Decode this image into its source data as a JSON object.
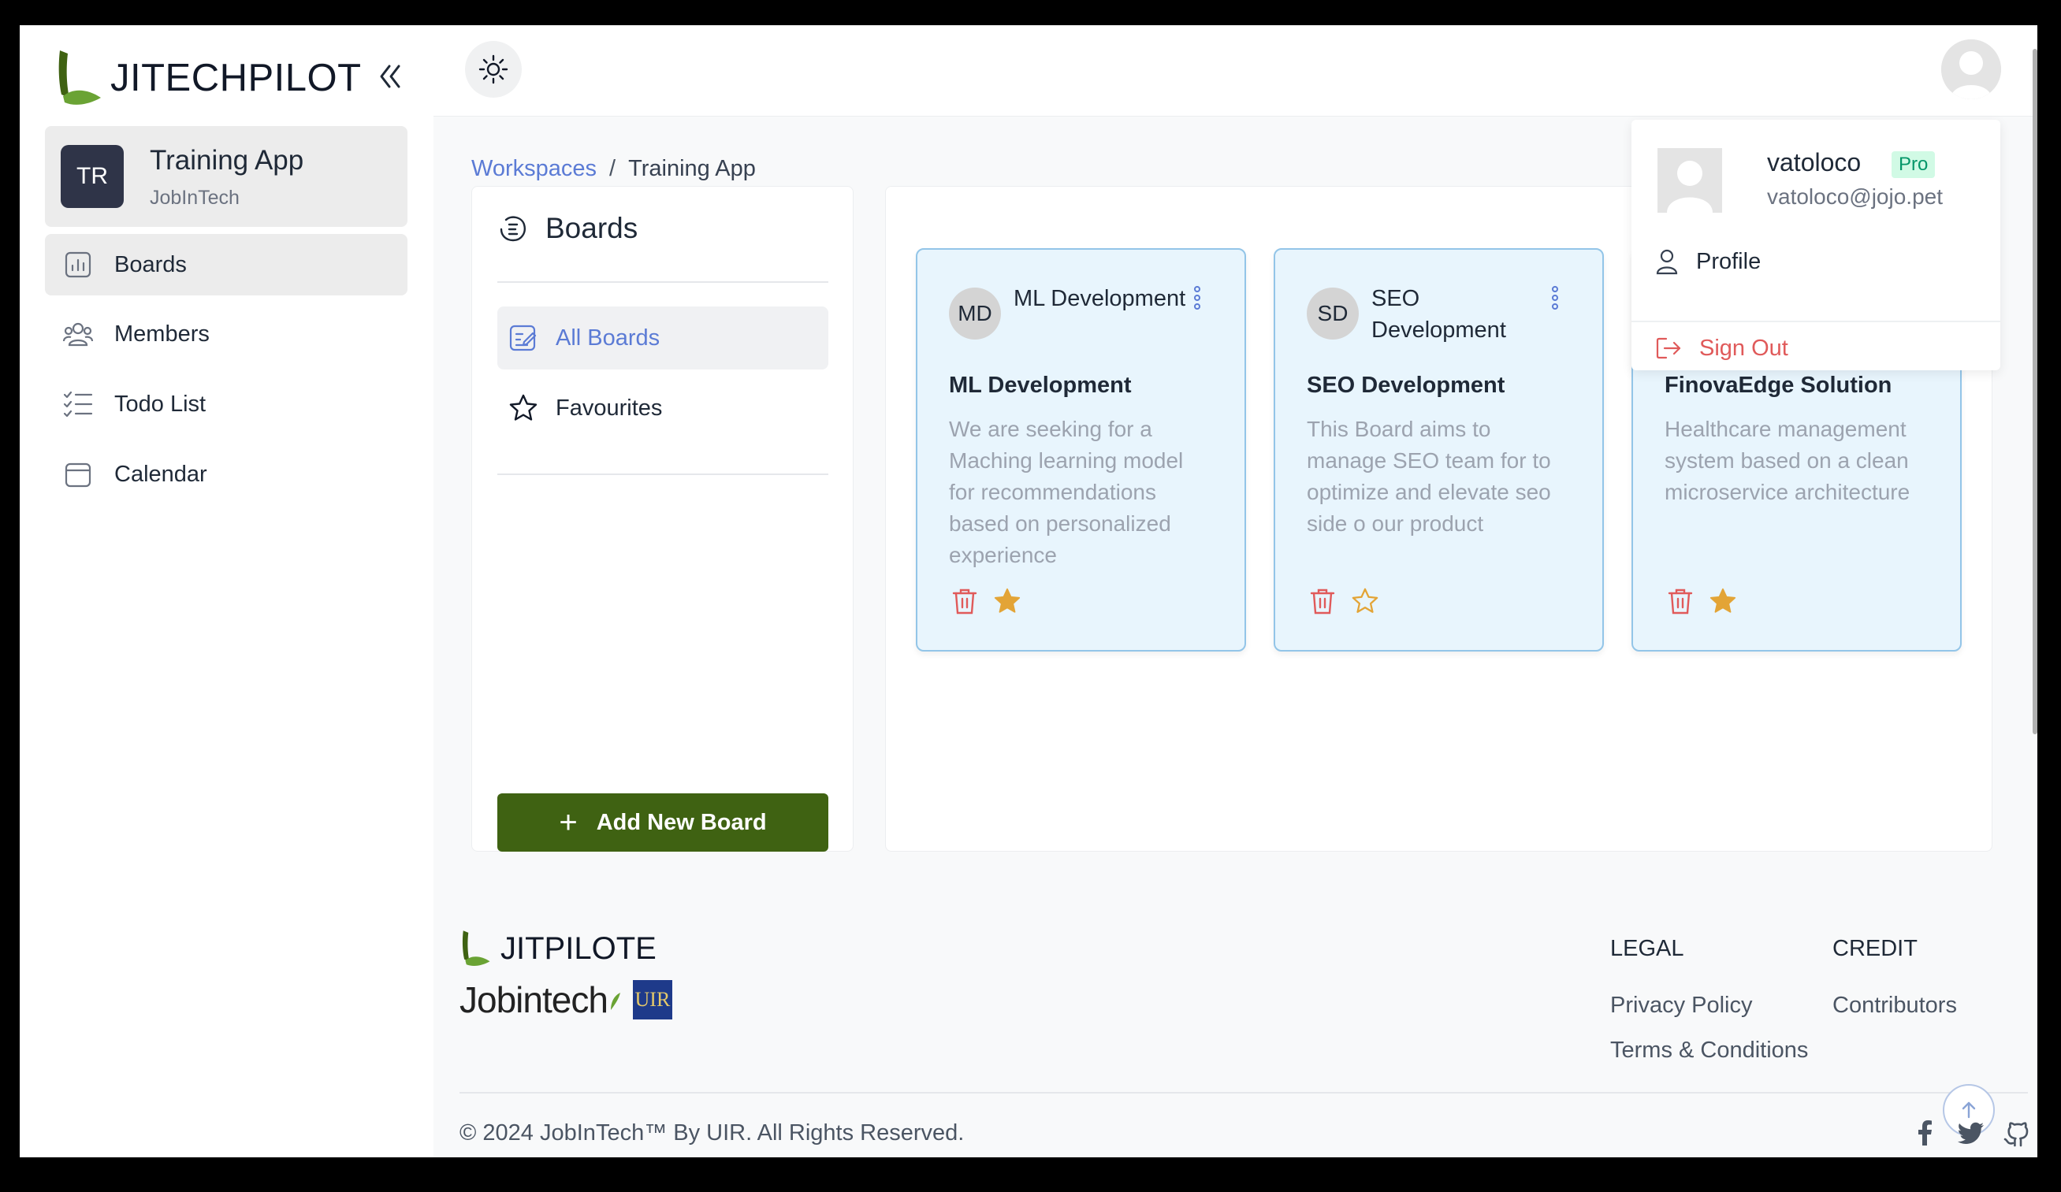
{
  "app": {
    "logo_text": "JITECHPILOT"
  },
  "workspace": {
    "initials": "TR",
    "name": "Training App",
    "org": "JobInTech"
  },
  "sidebar": {
    "items": [
      {
        "label": "Boards",
        "icon": "bar-chart-icon",
        "active": true
      },
      {
        "label": "Members",
        "icon": "users-icon"
      },
      {
        "label": "Todo List",
        "icon": "checklist-icon"
      },
      {
        "label": "Calendar",
        "icon": "calendar-icon"
      }
    ]
  },
  "breadcrumb": {
    "link": "Workspaces",
    "separator": "/",
    "current": "Training App"
  },
  "boards_panel": {
    "title": "Boards",
    "items": [
      {
        "label": "All Boards",
        "active": true
      },
      {
        "label": "Favourites"
      }
    ],
    "add_button": "Add New Board"
  },
  "boards": [
    {
      "initials": "MD",
      "header": "ML Development",
      "title": "ML Development",
      "description": "We are seeking for a Maching learning model for recommendations based on personalized experience",
      "favourite": true
    },
    {
      "initials": "SD",
      "header": "SEO Development",
      "title": "SEO Development",
      "description": "This Board aims to manage SEO team for to optimize and elevate seo side o our product",
      "favourite": false
    },
    {
      "initials": "",
      "header": "",
      "title": "FinovaEdge Solution",
      "description": "Healthcare management system based on a clean microservice architecture",
      "favourite": true
    }
  ],
  "user_menu": {
    "username": "vatoloco",
    "badge": "Pro",
    "email": "vatoloco@jojo.pet",
    "items": [
      {
        "label": "Profile"
      },
      {
        "label": "Sign Out"
      }
    ]
  },
  "footer": {
    "logo_text": "JITPILOTE",
    "partner_text": "Jobintech",
    "partner_badge": "UIR",
    "legal": {
      "heading": "LEGAL",
      "links": [
        "Privacy Policy",
        "Terms & Conditions"
      ]
    },
    "credit": {
      "heading": "CREDIT",
      "links": [
        "Contributors"
      ]
    },
    "copyright": "© 2024 JobInTech™ By UIR. All Rights Reserved."
  },
  "colors": {
    "primary_green": "#3f6212",
    "logo_green": "#6aa334",
    "link_blue": "#5b7bd5",
    "danger": "#e05a5a",
    "star": "#e3a436",
    "card_bg": "#e8f5fd",
    "card_border": "#93c5e8"
  }
}
